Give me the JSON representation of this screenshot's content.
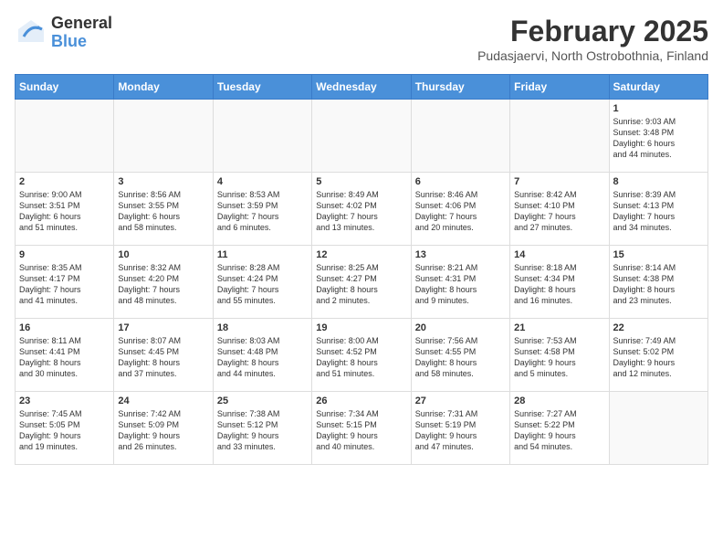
{
  "header": {
    "logo_general": "General",
    "logo_blue": "Blue",
    "month_title": "February 2025",
    "location": "Pudasjaervi, North Ostrobothnia, Finland"
  },
  "days_of_week": [
    "Sunday",
    "Monday",
    "Tuesday",
    "Wednesday",
    "Thursday",
    "Friday",
    "Saturday"
  ],
  "weeks": [
    [
      {
        "day": "",
        "info": ""
      },
      {
        "day": "",
        "info": ""
      },
      {
        "day": "",
        "info": ""
      },
      {
        "day": "",
        "info": ""
      },
      {
        "day": "",
        "info": ""
      },
      {
        "day": "",
        "info": ""
      },
      {
        "day": "1",
        "info": "Sunrise: 9:03 AM\nSunset: 3:48 PM\nDaylight: 6 hours\nand 44 minutes."
      }
    ],
    [
      {
        "day": "2",
        "info": "Sunrise: 9:00 AM\nSunset: 3:51 PM\nDaylight: 6 hours\nand 51 minutes."
      },
      {
        "day": "3",
        "info": "Sunrise: 8:56 AM\nSunset: 3:55 PM\nDaylight: 6 hours\nand 58 minutes."
      },
      {
        "day": "4",
        "info": "Sunrise: 8:53 AM\nSunset: 3:59 PM\nDaylight: 7 hours\nand 6 minutes."
      },
      {
        "day": "5",
        "info": "Sunrise: 8:49 AM\nSunset: 4:02 PM\nDaylight: 7 hours\nand 13 minutes."
      },
      {
        "day": "6",
        "info": "Sunrise: 8:46 AM\nSunset: 4:06 PM\nDaylight: 7 hours\nand 20 minutes."
      },
      {
        "day": "7",
        "info": "Sunrise: 8:42 AM\nSunset: 4:10 PM\nDaylight: 7 hours\nand 27 minutes."
      },
      {
        "day": "8",
        "info": "Sunrise: 8:39 AM\nSunset: 4:13 PM\nDaylight: 7 hours\nand 34 minutes."
      }
    ],
    [
      {
        "day": "9",
        "info": "Sunrise: 8:35 AM\nSunset: 4:17 PM\nDaylight: 7 hours\nand 41 minutes."
      },
      {
        "day": "10",
        "info": "Sunrise: 8:32 AM\nSunset: 4:20 PM\nDaylight: 7 hours\nand 48 minutes."
      },
      {
        "day": "11",
        "info": "Sunrise: 8:28 AM\nSunset: 4:24 PM\nDaylight: 7 hours\nand 55 minutes."
      },
      {
        "day": "12",
        "info": "Sunrise: 8:25 AM\nSunset: 4:27 PM\nDaylight: 8 hours\nand 2 minutes."
      },
      {
        "day": "13",
        "info": "Sunrise: 8:21 AM\nSunset: 4:31 PM\nDaylight: 8 hours\nand 9 minutes."
      },
      {
        "day": "14",
        "info": "Sunrise: 8:18 AM\nSunset: 4:34 PM\nDaylight: 8 hours\nand 16 minutes."
      },
      {
        "day": "15",
        "info": "Sunrise: 8:14 AM\nSunset: 4:38 PM\nDaylight: 8 hours\nand 23 minutes."
      }
    ],
    [
      {
        "day": "16",
        "info": "Sunrise: 8:11 AM\nSunset: 4:41 PM\nDaylight: 8 hours\nand 30 minutes."
      },
      {
        "day": "17",
        "info": "Sunrise: 8:07 AM\nSunset: 4:45 PM\nDaylight: 8 hours\nand 37 minutes."
      },
      {
        "day": "18",
        "info": "Sunrise: 8:03 AM\nSunset: 4:48 PM\nDaylight: 8 hours\nand 44 minutes."
      },
      {
        "day": "19",
        "info": "Sunrise: 8:00 AM\nSunset: 4:52 PM\nDaylight: 8 hours\nand 51 minutes."
      },
      {
        "day": "20",
        "info": "Sunrise: 7:56 AM\nSunset: 4:55 PM\nDaylight: 8 hours\nand 58 minutes."
      },
      {
        "day": "21",
        "info": "Sunrise: 7:53 AM\nSunset: 4:58 PM\nDaylight: 9 hours\nand 5 minutes."
      },
      {
        "day": "22",
        "info": "Sunrise: 7:49 AM\nSunset: 5:02 PM\nDaylight: 9 hours\nand 12 minutes."
      }
    ],
    [
      {
        "day": "23",
        "info": "Sunrise: 7:45 AM\nSunset: 5:05 PM\nDaylight: 9 hours\nand 19 minutes."
      },
      {
        "day": "24",
        "info": "Sunrise: 7:42 AM\nSunset: 5:09 PM\nDaylight: 9 hours\nand 26 minutes."
      },
      {
        "day": "25",
        "info": "Sunrise: 7:38 AM\nSunset: 5:12 PM\nDaylight: 9 hours\nand 33 minutes."
      },
      {
        "day": "26",
        "info": "Sunrise: 7:34 AM\nSunset: 5:15 PM\nDaylight: 9 hours\nand 40 minutes."
      },
      {
        "day": "27",
        "info": "Sunrise: 7:31 AM\nSunset: 5:19 PM\nDaylight: 9 hours\nand 47 minutes."
      },
      {
        "day": "28",
        "info": "Sunrise: 7:27 AM\nSunset: 5:22 PM\nDaylight: 9 hours\nand 54 minutes."
      },
      {
        "day": "",
        "info": ""
      }
    ]
  ]
}
